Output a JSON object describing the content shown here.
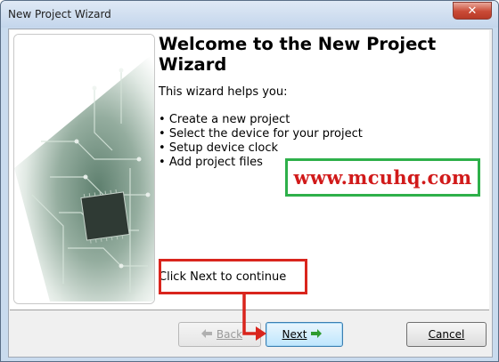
{
  "window": {
    "title": "New Project Wizard",
    "close_label": "✕"
  },
  "page": {
    "heading": "Welcome to the New Project Wizard",
    "intro": "This wizard helps you:",
    "bullets": [
      "Create a new project",
      "Select the device for your project",
      "Setup device clock",
      "Add project files"
    ],
    "footer_text": "Click Next to continue"
  },
  "watermark": "www.mcuhq.com",
  "buttons": {
    "back": "Back",
    "next": "Next",
    "cancel": "Cancel"
  },
  "colors": {
    "annotation_red": "#d9251d",
    "annotation_green": "#2eb04a",
    "watermark_text": "#d11a1a"
  }
}
